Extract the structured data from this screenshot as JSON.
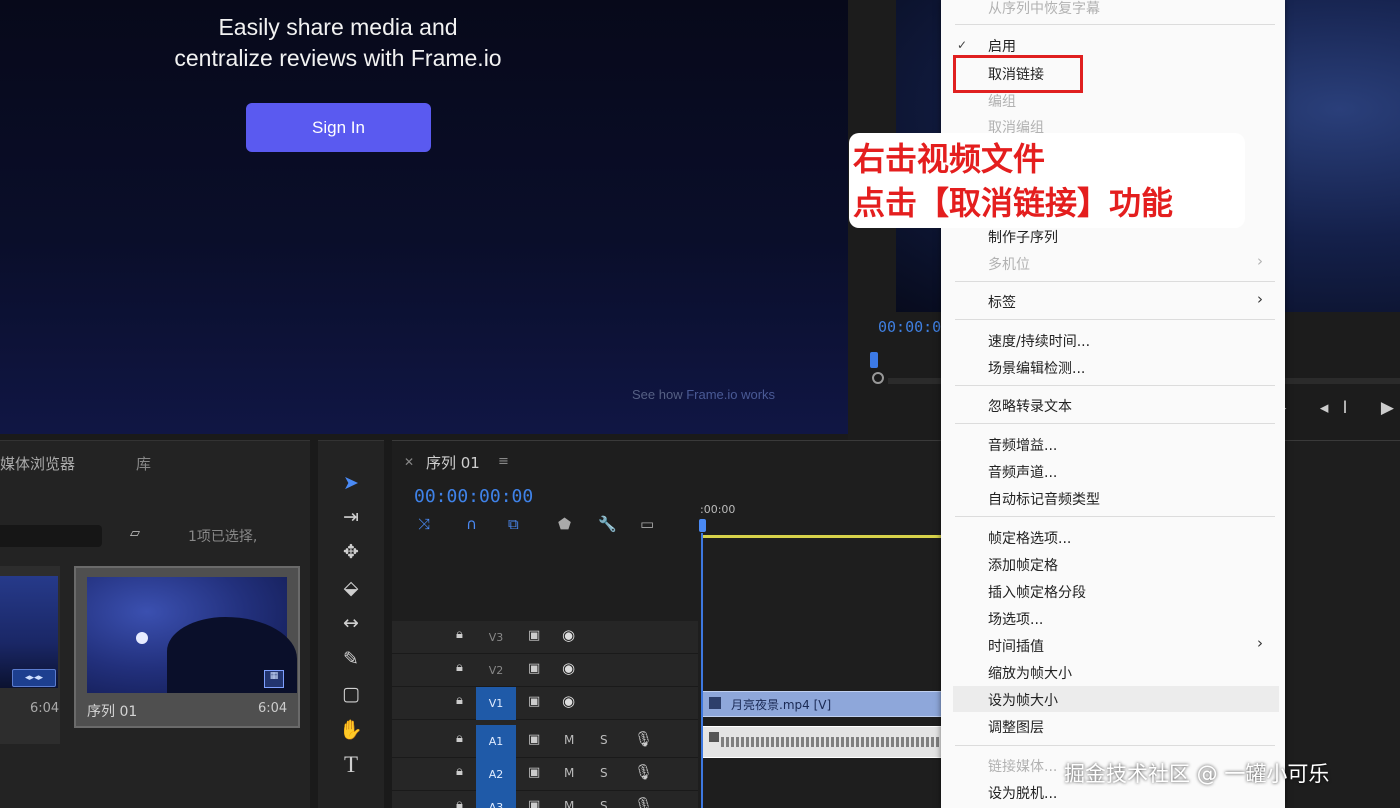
{
  "source_monitor": {
    "headline_line1": "Easily share media and",
    "headline_line2": "centralize reviews with Frame.io",
    "signin_label": "Sign In",
    "howto_prefix": "See how ",
    "howto_link": "Frame.io works"
  },
  "program_monitor": {
    "timecode": "00:00:0",
    "controls": "▸ ◂I ▶"
  },
  "project_panel": {
    "tab_media_browser": "媒体浏览器",
    "tab_library": "库",
    "selection_count": "1项已选择,",
    "clip_badge": "◂▸◂▸",
    "clip_duration": "6:04",
    "sequence_name": "序列 01",
    "sequence_duration": "6:04"
  },
  "timeline": {
    "tab_title": "序列 01",
    "timecode": "00:00:00:00",
    "ruler_label": ":00:00",
    "video_tracks": [
      {
        "name": "V3",
        "active": false
      },
      {
        "name": "V2",
        "active": false
      },
      {
        "name": "V1",
        "active": true
      }
    ],
    "audio_tracks": [
      {
        "name": "A1",
        "active": true,
        "mute": "M",
        "solo": "S"
      },
      {
        "name": "A2",
        "active": true,
        "mute": "M",
        "solo": "S"
      },
      {
        "name": "A3",
        "active": true,
        "mute": "M",
        "solo": "S"
      }
    ],
    "video_clip_name": "月亮夜景.mp4 [V]"
  },
  "context_menu": {
    "items": [
      {
        "label": "从序列中恢复字幕",
        "enabled": false,
        "submenu": false
      },
      {
        "label": "启用",
        "enabled": true,
        "checked": true,
        "submenu": false
      },
      {
        "label": "取消链接",
        "enabled": true,
        "submenu": false
      },
      {
        "label": "编组",
        "enabled": false,
        "submenu": false
      },
      {
        "label": "取消编组",
        "enabled": false,
        "submenu": false
      },
      {
        "label": "制作子序列",
        "enabled": true,
        "submenu": false
      },
      {
        "label": "多机位",
        "enabled": false,
        "submenu": true
      },
      {
        "label": "标签",
        "enabled": true,
        "submenu": true
      },
      {
        "label": "速度/持续时间...",
        "enabled": true,
        "submenu": false
      },
      {
        "label": "场景编辑检测...",
        "enabled": true,
        "submenu": false
      },
      {
        "label": "忽略转录文本",
        "enabled": true,
        "submenu": false
      },
      {
        "label": "音频增益...",
        "enabled": true,
        "submenu": false
      },
      {
        "label": "音频声道...",
        "enabled": true,
        "submenu": false
      },
      {
        "label": "自动标记音频类型",
        "enabled": true,
        "submenu": false
      },
      {
        "label": "帧定格选项...",
        "enabled": true,
        "submenu": false
      },
      {
        "label": "添加帧定格",
        "enabled": true,
        "submenu": false
      },
      {
        "label": "插入帧定格分段",
        "enabled": true,
        "submenu": false
      },
      {
        "label": "场选项...",
        "enabled": true,
        "submenu": false
      },
      {
        "label": "时间插值",
        "enabled": true,
        "submenu": true
      },
      {
        "label": "缩放为帧大小",
        "enabled": true,
        "submenu": false
      },
      {
        "label": "设为帧大小",
        "enabled": true,
        "submenu": false
      },
      {
        "label": "调整图层",
        "enabled": true,
        "submenu": false
      },
      {
        "label": "链接媒体...",
        "enabled": false,
        "submenu": false
      },
      {
        "label": "设为脱机...",
        "enabled": true,
        "submenu": false
      }
    ],
    "submenu_glyph": "›"
  },
  "annotation": {
    "line1": "右击视频文件",
    "line2": "点击【取消链接】功能"
  },
  "watermark": "掘金技术社区 @ 一罐小可乐",
  "colors": {
    "accent_blue": "#3f82e8",
    "annotation_red": "#e41e1e",
    "signin_button": "#5a5af0",
    "menu_background": "#fafafa"
  }
}
